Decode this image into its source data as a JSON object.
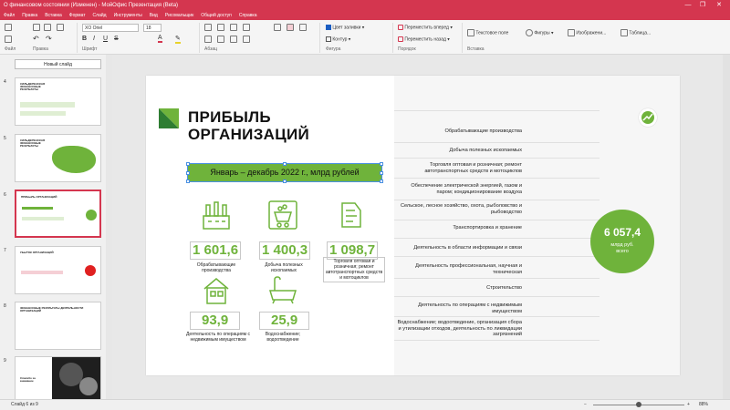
{
  "window": {
    "title": "О финансовом состоянии (Изменен) - МойОфис Презентация (Beta)",
    "minimize": "—",
    "restore": "❐",
    "close": "✕"
  },
  "menu": [
    "Файл",
    "Правка",
    "Вставка",
    "Формат",
    "Слайд",
    "Инструменты",
    "Вид",
    "Рисовальщик",
    "Общий доступ",
    "Справка"
  ],
  "ribbon": {
    "font_name": "XO Oriel",
    "font_size": "18",
    "fill_color_label": "Цвет заливки",
    "outline_label": "Контур",
    "bring_forward": "Переместить вперед",
    "send_backward": "Переместить назад",
    "text_field": "Текстовое поле",
    "shapes": "Фигуры",
    "image": "Изображени...",
    "table": "Таблица...",
    "groups": {
      "file": "Файл",
      "edit": "Правка",
      "font": "Шрифт",
      "paragraph": "Абзац",
      "shape": "Фигура",
      "order": "Порядок",
      "insert": "Вставка"
    }
  },
  "sidebar": {
    "new_slide_label": "Новый слайд",
    "thumbnails": [
      {
        "num": "4",
        "title": "СИЛЬДЕРЕНСКАЯ ФИНАНСОВЫЕ РЕЗУЛЬТАТЫ"
      },
      {
        "num": "5",
        "title": "СИЛЬДЕРЕНСКАЯ ФИНАНСОВЫЕ РЕЗУЛЬТАТЫ"
      },
      {
        "num": "6",
        "title": "ПРИБЫЛЬ ОРГАНИЗАЦИЙ"
      },
      {
        "num": "7",
        "title": "УБЫТОК ОРГАНИЗАЦИЙ"
      },
      {
        "num": "8",
        "title": "ФИНАНСОВЫЕ РЕЗУЛЬТАТЫ ДЕЯТЕЛЬНОСТИ ОРГАНИЗАЦИЙ"
      },
      {
        "num": "9",
        "title": "Спасибо за внимание"
      }
    ]
  },
  "slide": {
    "title_line1": "ПРИБЫЛЬ",
    "title_line2": "ОРГАНИЗАЦИЙ",
    "period": "Январь – декабрь 2022 г., млрд рублей",
    "stats": [
      {
        "value": "1 601,6",
        "label": "Обрабатывающие производства",
        "icon": "factory-icon"
      },
      {
        "value": "1 400,3",
        "label": "Добыча полезных ископаемых",
        "icon": "mining-cart-icon"
      },
      {
        "value": "1 098,7",
        "label": "Торговля оптовая и розничная; ремонт автотранспортных средств и мотоциклов",
        "icon": "cash-register-icon"
      },
      {
        "value": "93,9",
        "label": "Деятельность по операциям с недвижимым имуществом",
        "icon": "house-icon"
      },
      {
        "value": "25,9",
        "label": "Водоснабжение; водоотведение",
        "icon": "bathtub-icon"
      }
    ],
    "industries": [
      "Обрабатывающие производства",
      "Добыча полезных ископаемых",
      "Торговля оптовая и розничная; ремонт автотранспортных средств и мотоциклов",
      "Обеспечение электрической энергией, газом и паром; кондиционирование воздуха",
      "Сельское, лесное хозяйство, охота, рыболовство и рыбоводство",
      "Транспортировка и хранение",
      "Деятельность в области информации и связи",
      "Деятельность профессиональная, научная и техническая",
      "Строительство",
      "Деятельность по операциям с недвижимым имуществом",
      "Водоснабжение; водоотведение, организация сбора и утилизации отходов, деятельность по ликвидации загрязнений"
    ],
    "total_value": "6 057,4",
    "total_unit": "млрд руб.",
    "total_note": "всего"
  },
  "status": {
    "slide_info": "Слайд 6 из 9",
    "zoom": "88%"
  },
  "colors": {
    "accent": "#d4364f",
    "green": "#6fb33b"
  }
}
